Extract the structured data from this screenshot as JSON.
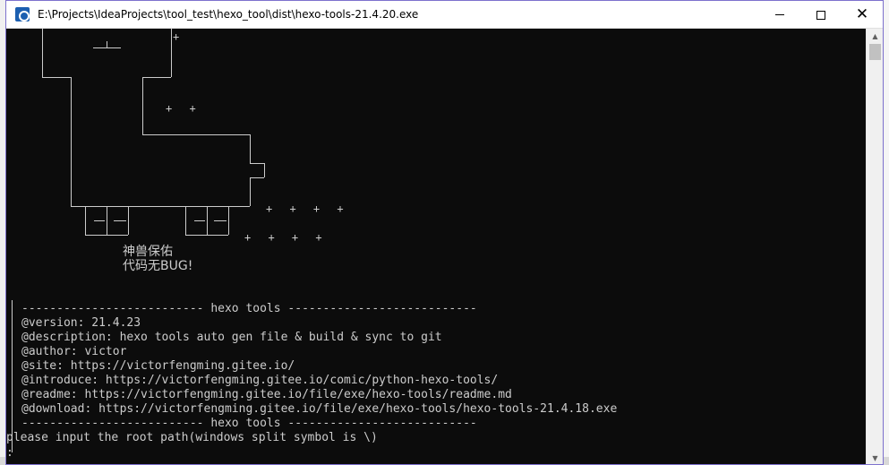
{
  "window": {
    "title": "E:\\Projects\\IdeaProjects\\tool_test\\hexo_tool\\dist\\hexo-tools-21.4.20.exe",
    "icon": "terminal-app-icon",
    "controls": {
      "minimize": "minimize",
      "maximize": "maximize",
      "close": "✕"
    }
  },
  "console": {
    "ascii_plus_rows": [
      "+",
      "+ +",
      "+ + + +",
      "+ + + +"
    ],
    "blessing": [
      "神兽保佑",
      "代码无BUG!"
    ],
    "lines": [
      "-------------------------- hexo tools ---------------------------",
      "@version: 21.4.23",
      "@description: hexo tools auto gen file & build & sync to git",
      "@author: victor",
      "@site: https://victorfengming.gitee.io/",
      "@introduce: https://victorfengming.gitee.io/comic/python-hexo-tools/",
      "@readme: https://victorfengming.gitee.io/file/exe/hexo-tools/readme.md",
      "@download: https://victorfengming.gitee.io/file/exe/hexo-tools/hexo-tools-21.4.18.exe",
      "-------------------------- hexo tools ---------------------------"
    ],
    "prompt": "please input the root path(windows split symbol is \\)",
    "cursor": ":"
  },
  "colors": {
    "console_bg": "#0c0c0c",
    "console_text": "#cccccc",
    "titlebar_bg": "#ffffff",
    "window_border": "#7e72ce"
  }
}
